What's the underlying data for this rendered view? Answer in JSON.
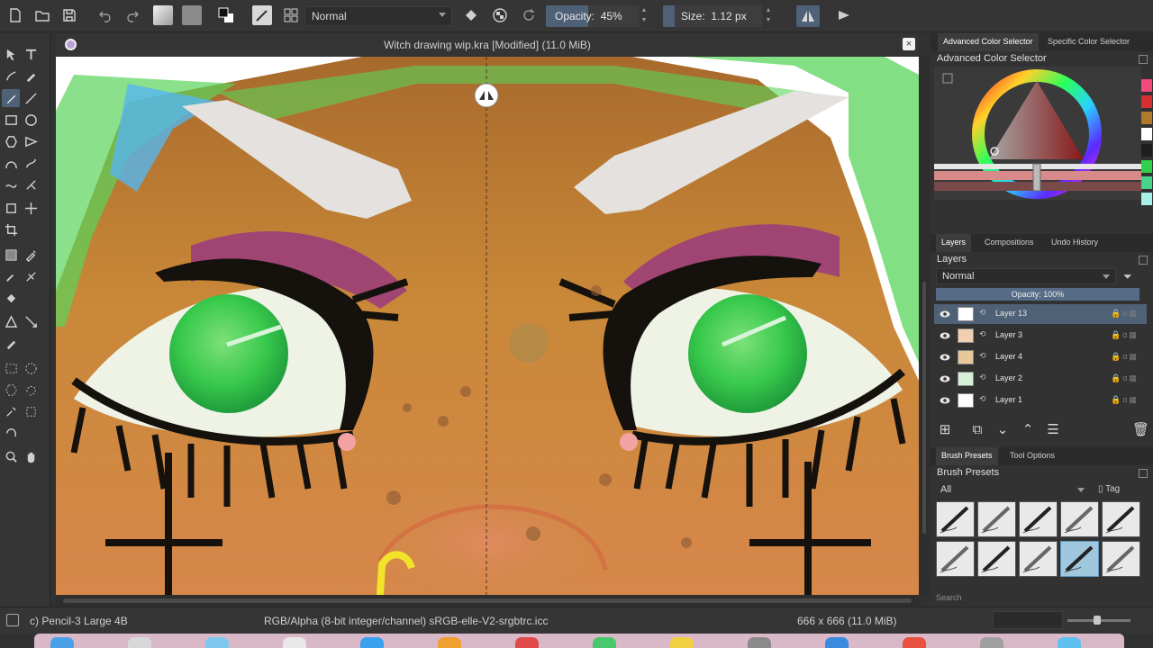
{
  "toolbar": {
    "blend_mode": "Normal",
    "opacity_label": "Opacity:",
    "opacity_value": "45%",
    "opacity_fraction": 0.45,
    "size_label": "Size:",
    "size_value": "1.12 px",
    "size_fraction": 0.12
  },
  "document": {
    "title": "Witch drawing wip.kra [Modified] (11.0 MiB)",
    "close_glyph": "×"
  },
  "color_panel": {
    "tabs": [
      "Advanced Color Selector",
      "Specific Color Selector"
    ],
    "title": "Advanced Color Selector",
    "swatches": [
      "#f24a7a",
      "#d62f2f",
      "#b07a2a",
      "#ffffff",
      "#1e1e1e",
      "#2fd14a",
      "#46d38c",
      "#a8f0e8"
    ]
  },
  "layers_panel": {
    "tabs": [
      "Layers",
      "Compositions",
      "Undo History"
    ],
    "title": "Layers",
    "blend_mode": "Normal",
    "opacity": "Opacity:  100%",
    "layers": [
      {
        "name": "Layer 13",
        "active": true
      },
      {
        "name": "Layer 3",
        "active": false
      },
      {
        "name": "Layer 4",
        "active": false
      },
      {
        "name": "Layer 2",
        "active": false
      },
      {
        "name": "Layer 1",
        "active": false
      }
    ]
  },
  "brush_panel": {
    "tabs": [
      "Brush Presets",
      "Tool Options"
    ],
    "title": "Brush Presets",
    "filter": "All",
    "tag_label": "Tag",
    "search_placeholder": "Search",
    "preset_count": 10,
    "selected_index": 8
  },
  "statusbar": {
    "brush": "c) Pencil-3 Large 4B",
    "color_model": "RGB/Alpha (8-bit integer/channel)  sRGB-elle-V2-srgbtrc.icc",
    "image_size": "666 x 666 (11.0 MiB)"
  },
  "colors": {
    "accent": "#4f6176",
    "skin": "#d08a4a",
    "hair": "#5ad45a",
    "iris": "#38c94c"
  }
}
